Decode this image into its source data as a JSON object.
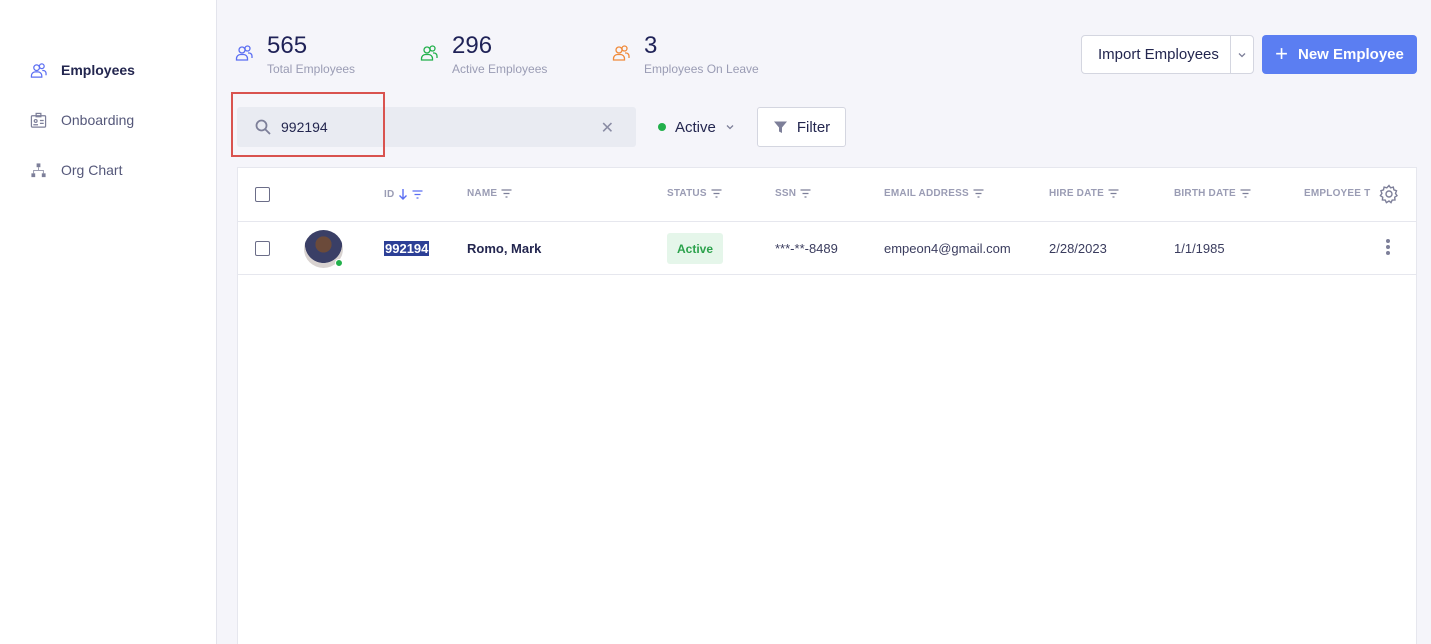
{
  "sidebar": {
    "items": [
      {
        "label": "Employees",
        "icon": "users-icon",
        "active": true
      },
      {
        "label": "Onboarding",
        "icon": "id-card-icon",
        "active": false
      },
      {
        "label": "Org Chart",
        "icon": "org-chart-icon",
        "active": false
      }
    ]
  },
  "stats": [
    {
      "value": "565",
      "label": "Total Employees",
      "color": "#5b6ef2"
    },
    {
      "value": "296",
      "label": "Active Employees",
      "color": "#22b04b"
    },
    {
      "value": "3",
      "label": "Employees On Leave",
      "color": "#f08a3a"
    }
  ],
  "toolbar": {
    "import_label": "Import Employees",
    "new_label": "New Employee",
    "search_value": "992194",
    "status_label": "Active",
    "filter_label": "Filter"
  },
  "table": {
    "columns": [
      "ID",
      "NAME",
      "STATUS",
      "SSN",
      "EMAIL ADDRESS",
      "HIRE DATE",
      "BIRTH DATE",
      "EMPLOYEE T"
    ],
    "rows": [
      {
        "id": "992194",
        "name": "Romo, Mark",
        "status": "Active",
        "ssn": "***-**-8489",
        "email": "empeon4@gmail.com",
        "hire_date": "2/28/2023",
        "birth_date": "1/1/1985"
      }
    ]
  },
  "colors": {
    "accent": "#5b7ef2",
    "active_green": "#22b04b",
    "highlight_red": "#d9534f"
  }
}
